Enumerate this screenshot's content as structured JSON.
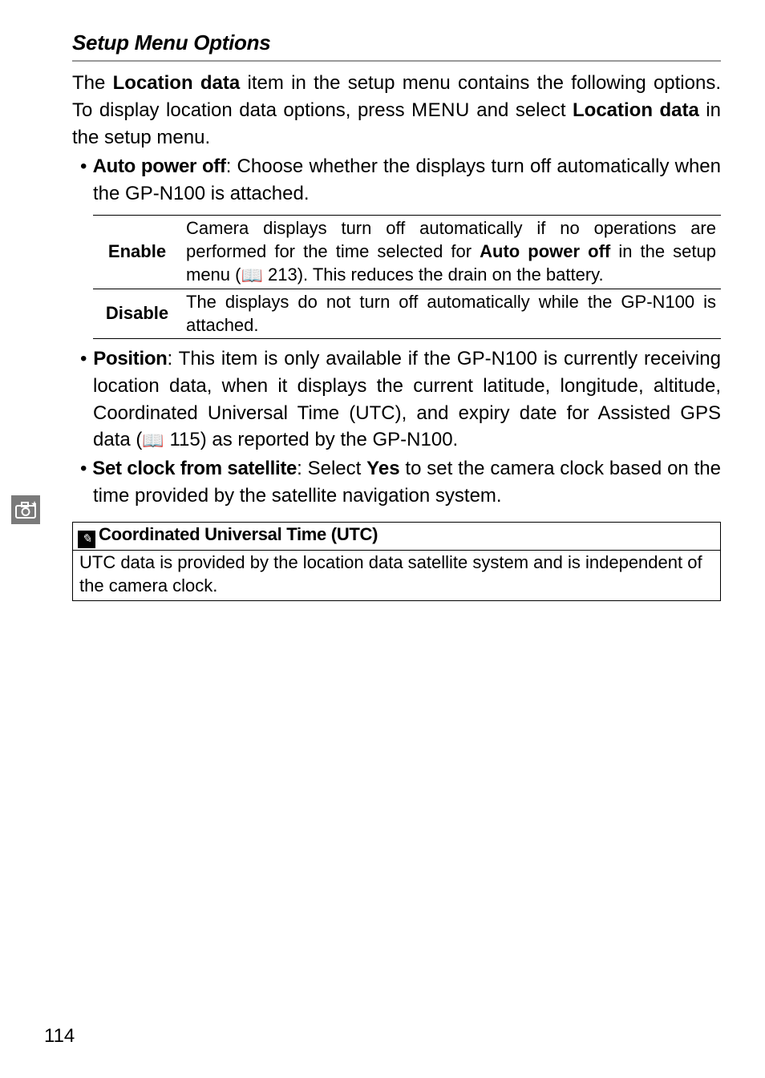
{
  "heading": "Setup Menu Options",
  "intro_pre": "The ",
  "intro_bold1": "Location data",
  "intro_mid1": " item in the setup menu contains the following options. To display location data options, press ",
  "intro_menu": "MENU",
  "intro_mid2": " and select ",
  "intro_bold2": "Location data",
  "intro_post": " in the setup menu.",
  "bullet1_title": "Auto power off",
  "bullet1_text": ": Choose whether the displays turn off automatically when the GP-N100 is attached.",
  "table": {
    "row1_label": "Enable",
    "row1_text_pre": "Camera displays turn off automatically if no operations are performed for the time selected for ",
    "row1_text_bold": "Auto power off",
    "row1_text_mid": " in the setup menu (",
    "row1_ref": " 213). This reduces the drain on the battery.",
    "row2_label": "Disable",
    "row2_text": "The displays do not turn off automatically while the GP-N100 is attached."
  },
  "bullet2_title": "Position",
  "bullet2_text_pre": ": This item is only available if the GP-N100 is currently receiving location data, when it displays the current latitude, longitude, altitude, Coordinated Universal Time (UTC), and expiry date for Assisted GPS data (",
  "bullet2_ref": " 115) as reported by the GP-N100.",
  "bullet3_title": "Set clock from satellite",
  "bullet3_text_pre": ": Select ",
  "bullet3_bold": "Yes",
  "bullet3_text_post": " to set the camera clock based on the time provided by the satellite navigation system.",
  "notebox": {
    "title": "Coordinated Universal Time (UTC)",
    "body": "UTC data is provided by the location data satellite system and is independent of the camera clock."
  },
  "page_number": "114"
}
